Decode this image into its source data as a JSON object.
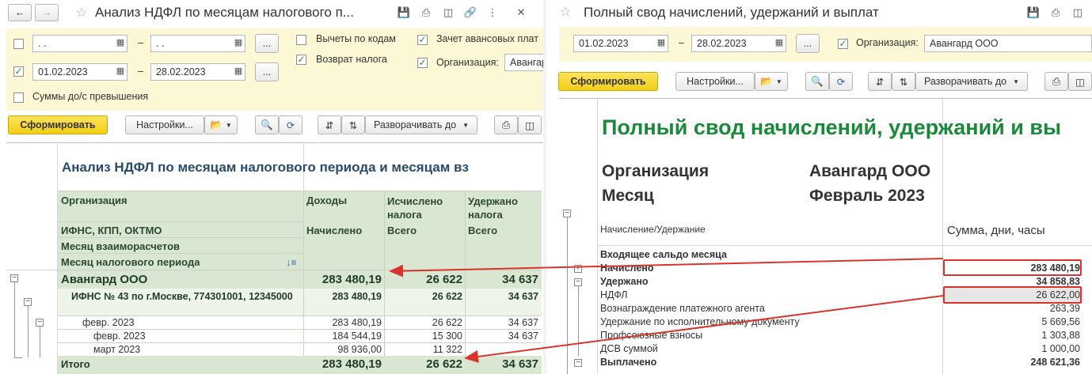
{
  "left": {
    "window_title": "Анализ НДФЛ по месяцам налогового п...",
    "filters": {
      "row1_from": ". .",
      "row1_to": ". .",
      "dash": "–",
      "more": "...",
      "row2_from": "01.02.2023",
      "row2_to": "28.02.2023",
      "sums_exceed_label": "Суммы до/с превышения",
      "deductions_label": "Вычеты по кодам",
      "tax_return_label": "Возврат налога",
      "advance_offset_label": "Зачет авансовых плат",
      "org_label": "Организация:",
      "org_value": "Авангард"
    },
    "toolbar": {
      "generate": "Сформировать",
      "settings": "Настройки...",
      "expand": "Разворачивать до"
    },
    "report": {
      "title": "Анализ НДФЛ по месяцам налогового периода и месяцам вз",
      "col_org": "Организация",
      "col_income": "Доходы",
      "col_calc": "Исчислено налога",
      "col_withheld": "Удержано налога",
      "sub_ifns": "ИФНС, КПП, ОКТМО",
      "sub_accrued": "Начислено",
      "sub_total1": "Всего",
      "sub_total2": "Всего",
      "sub_month_settle": "Месяц взаиморасчетов",
      "sub_month_period": "Месяц налогового периода",
      "rows": [
        {
          "name": "Авангард ООО",
          "income": "283 480,19",
          "calc": "26 622",
          "withheld": "34 637"
        },
        {
          "name": "ИФНС № 43 по г.Москве, 774301001, 12345000",
          "income": "283 480,19",
          "calc": "26 622",
          "withheld": "34 637"
        },
        {
          "name": "февр. 2023",
          "income": "283 480,19",
          "calc": "26 622",
          "withheld": "34 637"
        },
        {
          "name": "февр. 2023",
          "income": "184 544,19",
          "calc": "15 300",
          "withheld": "34 637"
        },
        {
          "name": "март 2023",
          "income": "98 936,00",
          "calc": "11 322",
          "withheld": ""
        }
      ],
      "total": {
        "name": "Итого",
        "income": "283 480,19",
        "calc": "26 622",
        "withheld": "34 637"
      }
    }
  },
  "right": {
    "window_title": "Полный свод начислений, удержаний и выплат",
    "filters": {
      "from": "01.02.2023",
      "to": "28.02.2023",
      "dash": "–",
      "more": "...",
      "org_label": "Организация:",
      "org_value": "Авангард ООО"
    },
    "toolbar": {
      "generate": "Сформировать",
      "settings": "Настройки...",
      "expand": "Разворачивать до"
    },
    "report": {
      "title": "Полный свод начислений, удержаний и вы",
      "org_label": "Организация",
      "org_value": "Авангард ООО",
      "month_label": "Месяц",
      "month_value": "Февраль 2023",
      "col_item": "Начисление/Удержание",
      "col_sum": "Сумма, дни, часы",
      "rows": [
        {
          "name": "Входящее сальдо месяца",
          "value": ""
        },
        {
          "name": "Начислено",
          "value": "283 480,19"
        },
        {
          "name": "Удержано",
          "value": "34 858,83"
        },
        {
          "name": "НДФЛ",
          "value": "26 622,00"
        },
        {
          "name": "Вознаграждение платежного агента",
          "value": "263,39"
        },
        {
          "name": "Удержание по исполнительному документу",
          "value": "5 669,56"
        },
        {
          "name": "Профсоюзные взносы",
          "value": "1 303,88"
        },
        {
          "name": "ДСВ суммой",
          "value": "1 000,00"
        },
        {
          "name": "Выплачено",
          "value": "248 621,36"
        }
      ]
    }
  },
  "colors": {
    "highlight": "#d9342b",
    "green_title": "#1a8a3a",
    "header_bg": "#d9e6d2",
    "yellow": "#f3d21a"
  }
}
